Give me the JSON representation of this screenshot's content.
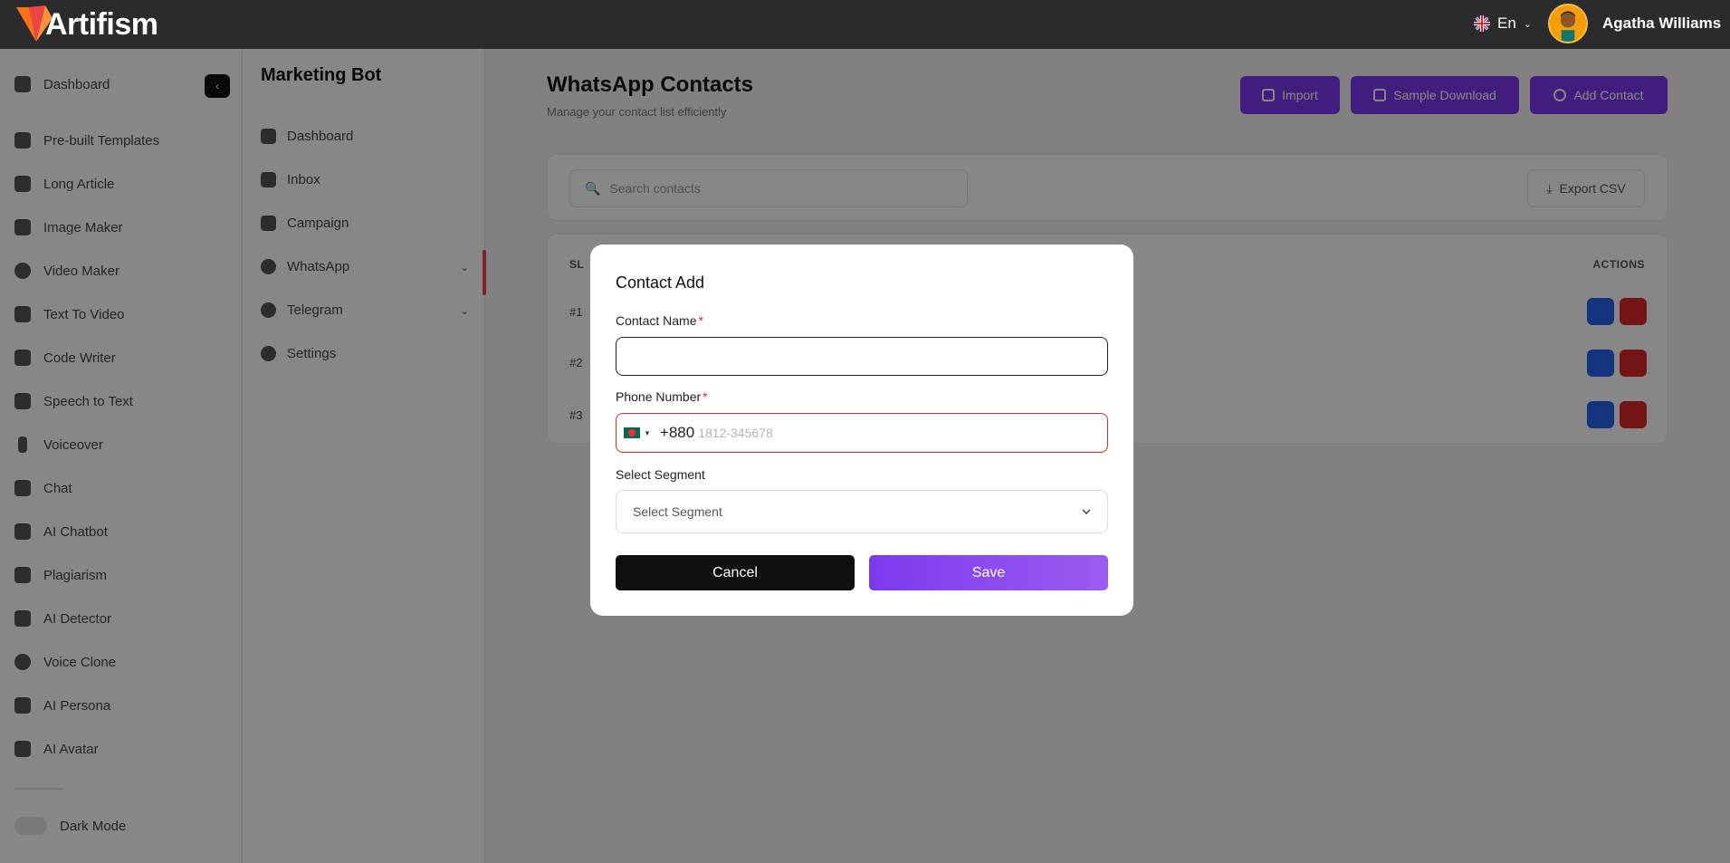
{
  "topbar": {
    "brand": "Artifism",
    "language": "En",
    "user_name": "Agatha Williams"
  },
  "sidebar": {
    "collapse_label": "‹",
    "items": [
      {
        "label": "Dashboard"
      },
      {
        "label": "Pre-built Templates"
      },
      {
        "label": "Long Article"
      },
      {
        "label": "Image Maker"
      },
      {
        "label": "Video Maker"
      },
      {
        "label": "Text To Video"
      },
      {
        "label": "Code Writer"
      },
      {
        "label": "Speech to Text"
      },
      {
        "label": "Voiceover"
      },
      {
        "label": "Chat"
      },
      {
        "label": "AI Chatbot"
      },
      {
        "label": "Plagiarism"
      },
      {
        "label": "AI Detector"
      },
      {
        "label": "Voice Clone"
      },
      {
        "label": "AI Persona"
      },
      {
        "label": "AI Avatar"
      }
    ],
    "dark_mode_label": "Dark Mode"
  },
  "panel2": {
    "title": "Marketing Bot",
    "items": [
      {
        "label": "Dashboard"
      },
      {
        "label": "Inbox"
      },
      {
        "label": "Campaign"
      },
      {
        "label": "WhatsApp"
      },
      {
        "label": "Telegram"
      },
      {
        "label": "Settings"
      }
    ]
  },
  "main": {
    "title": "WhatsApp Contacts",
    "subtitle": "Manage your contact list efficiently",
    "import_label": "Import",
    "sample_label": "Sample Download",
    "add_label": "Add Contact",
    "search_placeholder": "Search contacts",
    "export_label": "Export CSV",
    "col_sl": "SL",
    "col_actions": "ACTIONS",
    "rows": [
      {
        "sl": "#1"
      },
      {
        "sl": "#2"
      },
      {
        "sl": "#3"
      }
    ]
  },
  "modal": {
    "title": "Contact Add",
    "name_label": "Contact Name",
    "required_mark": "*",
    "name_value": "",
    "phone_label": "Phone Number",
    "dial_code": "+880",
    "phone_placeholder": "1812-345678",
    "segment_label": "Select Segment",
    "segment_value": "Select Segment",
    "cancel_label": "Cancel",
    "save_label": "Save"
  },
  "colors": {
    "accent": "#7c3aed",
    "error": "#dc2626",
    "topbar": "#2b2b2d"
  },
  "icons": [
    "artifism-logo-icon",
    "uk-flag-icon",
    "chevron-down-icon",
    "bangladesh-flag-icon",
    "search-icon",
    "download-icon",
    "plus-icon",
    "edit-icon",
    "delete-icon"
  ]
}
